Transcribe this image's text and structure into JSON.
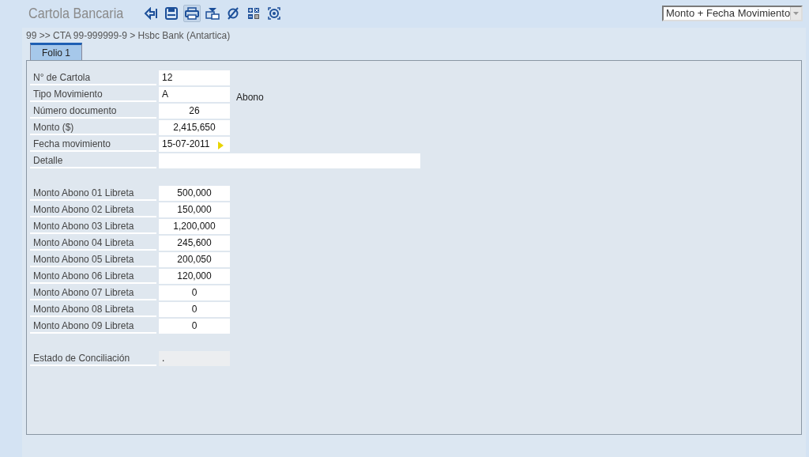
{
  "header": {
    "title": "Cartola Bancaria",
    "sort_select": {
      "value": "Monto + Fecha Movimiento"
    }
  },
  "toolbar": [
    {
      "kind": "back",
      "selected": false
    },
    {
      "kind": "save",
      "selected": false
    },
    {
      "kind": "print",
      "selected": true
    },
    {
      "kind": "export",
      "selected": false
    },
    {
      "kind": "cancel",
      "selected": false
    },
    {
      "kind": "calculator",
      "selected": false
    },
    {
      "kind": "target",
      "selected": false
    }
  ],
  "breadcrumb": "99 >> CTA 99-999999-9 > Hsbc Bank  (Antartica)",
  "tabs": [
    {
      "label": "Folio 1",
      "selected": true
    }
  ],
  "groups": [
    [
      {
        "label": "N° de Cartola",
        "value": "12",
        "kind": "text"
      },
      {
        "label": "Tipo Movimiento",
        "value": "A",
        "kind": "text",
        "note": "Abono"
      },
      {
        "label": "Número documento",
        "value": "26",
        "kind": "number"
      },
      {
        "label": "Monto ($)",
        "value": "2,415,650",
        "kind": "number"
      },
      {
        "label": "Fecha movimiento",
        "value": "15-07-2011",
        "kind": "date"
      },
      {
        "label": "Detalle",
        "kind": "wide"
      }
    ],
    [
      {
        "label": "Monto Abono 01 Libreta",
        "value": "500,000",
        "kind": "number"
      },
      {
        "label": "Monto Abono 02 Libreta",
        "value": "150,000",
        "kind": "number"
      },
      {
        "label": "Monto Abono 03 Libreta",
        "value": "1,200,000",
        "kind": "number"
      },
      {
        "label": "Monto Abono 04 Libreta",
        "value": "245,600",
        "kind": "number"
      },
      {
        "label": "Monto Abono 05 Libreta",
        "value": "200,050",
        "kind": "number"
      },
      {
        "label": "Monto Abono 06 Libreta",
        "value": "120,000",
        "kind": "number"
      },
      {
        "label": "Monto Abono 07 Libreta",
        "value": "0",
        "kind": "number"
      },
      {
        "label": "Monto Abono 08 Libreta",
        "value": "0",
        "kind": "number"
      },
      {
        "label": "Monto Abono 09 Libreta",
        "value": "0",
        "kind": "number"
      }
    ],
    [
      {
        "label": "Estado de Conciliación",
        "value": ".",
        "kind": "readonly"
      }
    ]
  ]
}
